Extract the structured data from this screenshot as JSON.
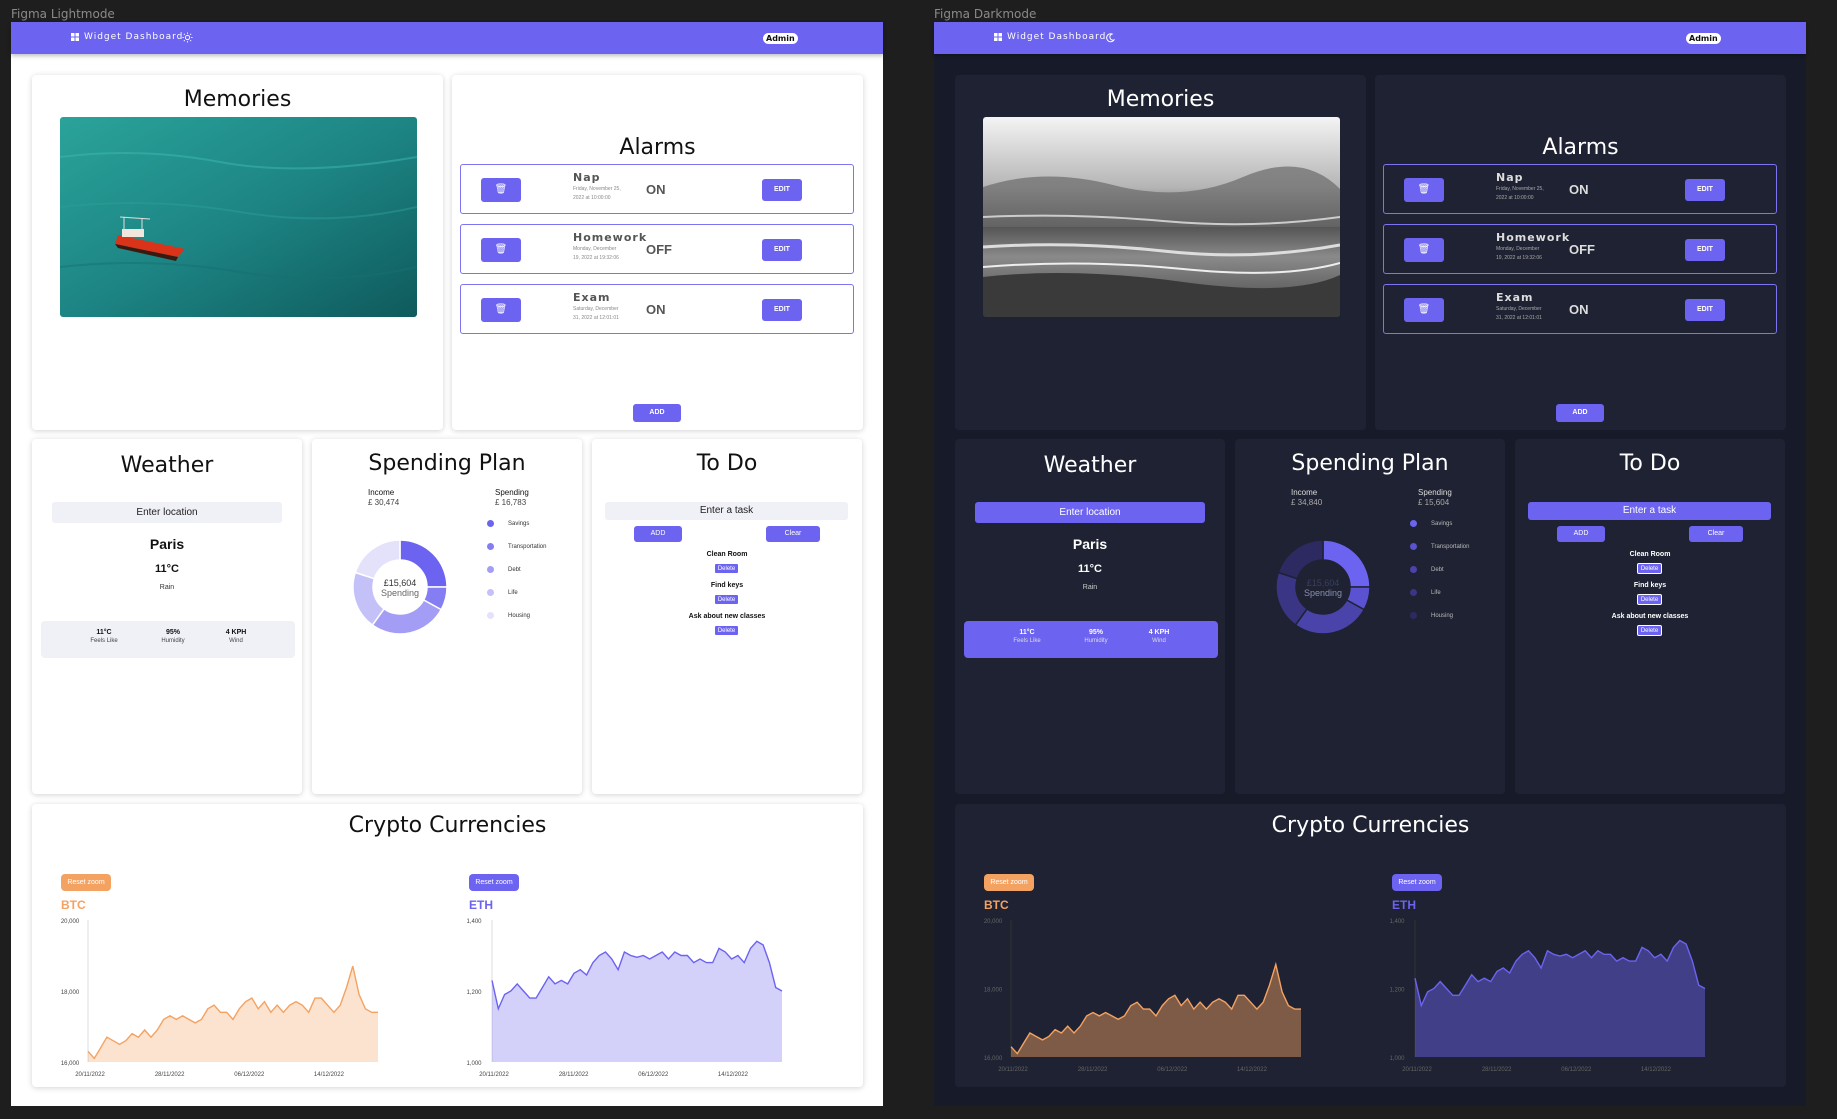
{
  "frames": {
    "light_label": "Figma Lightmode",
    "dark_label": "Figma Darkmode"
  },
  "nav": {
    "title": "Widget Dashboard",
    "admin": "Admin",
    "light_icon": "sun-icon",
    "dark_icon": "moon-icon",
    "color": "#6c63f0"
  },
  "memories": {
    "title": "Memories",
    "light_image": "boat-on-turquoise-sea",
    "dark_image": "black-and-white-beach-under-clouds"
  },
  "alarms": {
    "title": "Alarms",
    "edit_label": "EDIT",
    "delete_icon": "trash-icon",
    "add_label": "ADD",
    "items": [
      {
        "name": "Nap",
        "date": "Friday, November 25, 2022 at 10:00:00",
        "state": "ON"
      },
      {
        "name": "Homework",
        "date": "Monday, December 19, 2022 at 19:32:06",
        "state": "OFF"
      },
      {
        "name": "Exam",
        "date": "Saturday, December 31, 2022 at 12:01:01",
        "state": "ON"
      }
    ]
  },
  "weather": {
    "title": "Weather",
    "input_placeholder": "Enter location",
    "city": "Paris",
    "temp": "11°C",
    "condition": "Rain",
    "stats": [
      {
        "value": "11°C",
        "label": "Feels Like"
      },
      {
        "value": "95%",
        "label": "Humidity"
      },
      {
        "value": "4 KPH",
        "label": "Wind"
      }
    ]
  },
  "spending_light": {
    "title": "Spending Plan",
    "income_label": "Income",
    "income_value": "£ 30,474",
    "spending_label": "Spending",
    "spending_value": "£ 16,783",
    "center_amount": "£15,604",
    "center_label": "Spending",
    "legend": [
      "Savings",
      "Transportation",
      "Debt",
      "Life",
      "Housing"
    ],
    "colors": [
      "#6c63f0",
      "#857df2",
      "#a39df5",
      "#c4c0f8",
      "#e4e2fb"
    ]
  },
  "spending_dark": {
    "title": "Spending Plan",
    "income_label": "Income",
    "income_value": "£ 34,840",
    "spending_label": "Spending",
    "spending_value": "£ 15,604",
    "center_amount": "£15,604",
    "center_label": "Spending",
    "legend": [
      "Savings",
      "Transportation",
      "Debt",
      "Life",
      "Housing"
    ],
    "colors": [
      "#6c63f0",
      "#5a52d0",
      "#4a44aa",
      "#3a3585",
      "#2c2a60"
    ]
  },
  "todo": {
    "title": "To Do",
    "input_placeholder": "Enter a task",
    "add_label": "ADD",
    "clear_label": "Clear",
    "delete_label": "Delete",
    "items": [
      "Clean Room",
      "Find keys",
      "Ask about new classes"
    ]
  },
  "crypto": {
    "title": "Crypto Currencies",
    "reset_label": "Reset zoom"
  },
  "chart_data": [
    {
      "type": "area",
      "series": [
        {
          "name": "BTC",
          "values": [
            16300,
            16100,
            16400,
            16700,
            16600,
            16500,
            16600,
            16800,
            16700,
            16900,
            16700,
            16900,
            17200,
            17300,
            17200,
            17300,
            17200,
            17100,
            17200,
            17500,
            17600,
            17400,
            17400,
            17200,
            17500,
            17700,
            17800,
            17500,
            17700,
            17400,
            17600,
            17400,
            17600,
            17700,
            17600,
            17400,
            17800,
            17800,
            17600,
            17400,
            17600,
            18100,
            18700,
            17900,
            17500,
            17400,
            17400
          ]
        }
      ],
      "x_ticks": [
        "20/11/2022",
        "28/11/2022",
        "06/12/2022",
        "14/12/2022"
      ],
      "y_ticks": [
        "16,000",
        "18,000",
        "20,000"
      ],
      "ylim": [
        16000,
        20000
      ],
      "color": "#f4a261"
    },
    {
      "type": "area",
      "series": [
        {
          "name": "ETH",
          "values": [
            1230,
            1150,
            1190,
            1200,
            1220,
            1200,
            1180,
            1180,
            1210,
            1240,
            1220,
            1230,
            1220,
            1250,
            1260,
            1245,
            1280,
            1300,
            1310,
            1290,
            1260,
            1310,
            1300,
            1295,
            1300,
            1290,
            1300,
            1310,
            1290,
            1310,
            1300,
            1300,
            1280,
            1290,
            1280,
            1280,
            1320,
            1310,
            1290,
            1300,
            1280,
            1320,
            1340,
            1330,
            1280,
            1210,
            1200
          ]
        }
      ],
      "x_ticks": [
        "20/11/2022",
        "28/11/2022",
        "06/12/2022",
        "14/12/2022"
      ],
      "y_ticks": [
        "1,000",
        "1,200",
        "1,400"
      ],
      "ylim": [
        1000,
        1400
      ],
      "color": "#6c63f0"
    }
  ]
}
